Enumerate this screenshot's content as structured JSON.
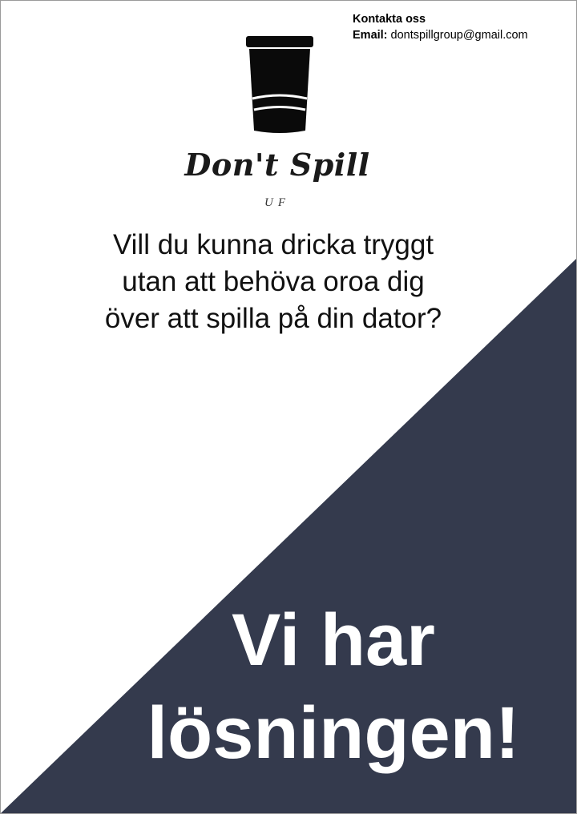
{
  "contact": {
    "heading": "Kontakta oss",
    "email_label": "Email:",
    "email_value": "dontspillgroup@gmail.com"
  },
  "logo": {
    "icon": "cup-icon",
    "name": "Don't Spill",
    "suffix": "UF"
  },
  "question": {
    "line1": "Vill du kunna dricka tryggt",
    "line2": "utan att behöva oroa dig",
    "line3": "över att spilla på din dator?"
  },
  "headline": {
    "line1": "Vi har",
    "line2": "lösningen!"
  },
  "colors": {
    "background": "#ffffff",
    "accent_navy": "#343a4d",
    "text": "#111111",
    "headline_text": "#ffffff"
  }
}
